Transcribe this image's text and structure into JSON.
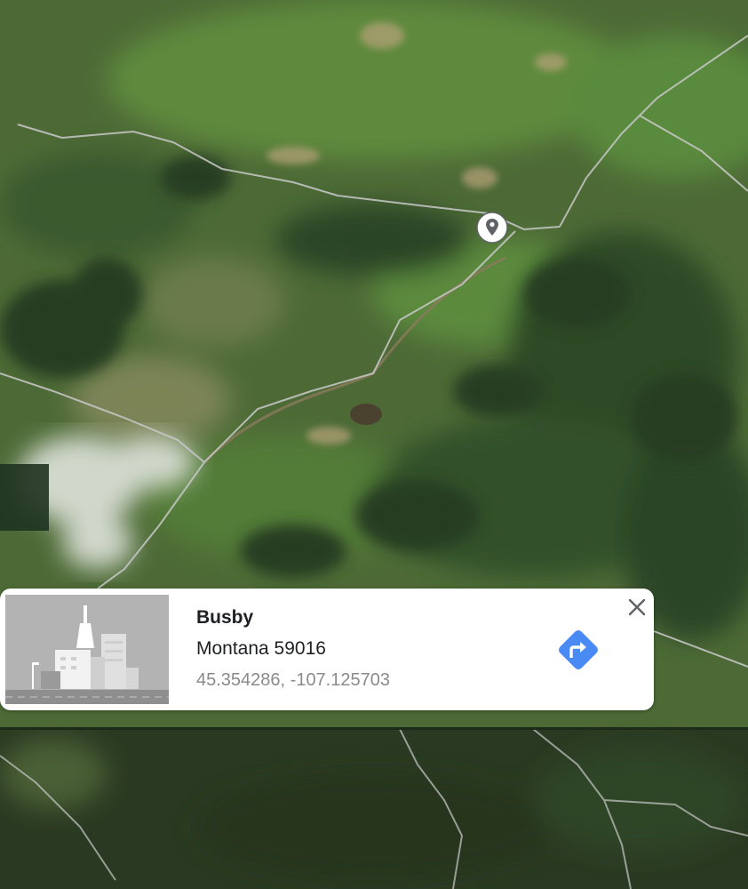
{
  "colors": {
    "card_background": "#ffffff",
    "title_text": "#202124",
    "coordinates_text": "#8a8a8a",
    "directions_button": "#4a8af4",
    "map_road": "#c9c9c9"
  },
  "icons": {
    "pin": "location-pin-icon",
    "close": "close-icon",
    "directions": "directions-icon",
    "thumbnail": "city-placeholder-image"
  },
  "place_card": {
    "title": "Busby",
    "address": "Montana 59016",
    "coordinates": "45.354286, -107.125703"
  }
}
